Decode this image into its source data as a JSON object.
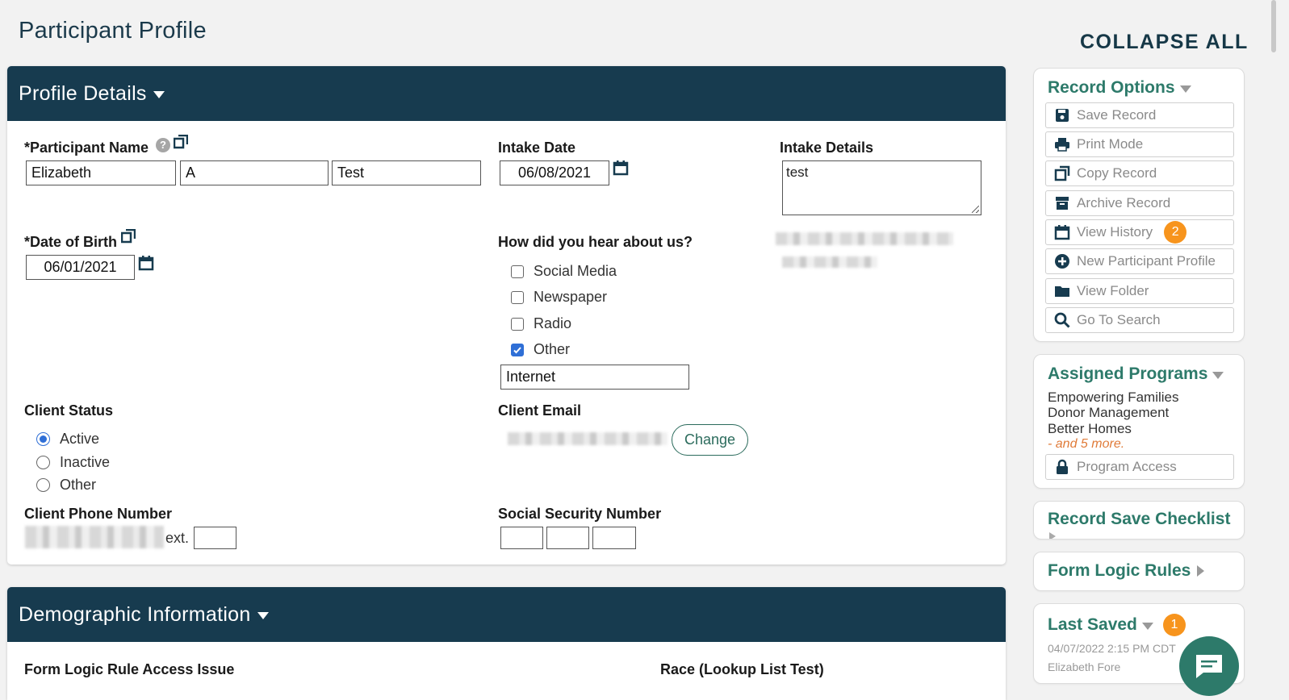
{
  "page": {
    "title": "Participant Profile",
    "collapse_all": "COLLAPSE ALL"
  },
  "profile_details": {
    "header": "Profile Details",
    "participant_name": {
      "label": "*Participant Name",
      "first": "Elizabeth",
      "middle": "A",
      "last": "Test"
    },
    "intake_date": {
      "label": "Intake Date",
      "value": "06/08/2021"
    },
    "intake_details": {
      "label": "Intake Details",
      "value": "test"
    },
    "date_of_birth": {
      "label": "*Date of Birth",
      "value": "06/01/2021"
    },
    "how_heard": {
      "label": "How did you hear about us?",
      "options": [
        {
          "label": "Social Media",
          "checked": false
        },
        {
          "label": "Newspaper",
          "checked": false
        },
        {
          "label": "Radio",
          "checked": false
        },
        {
          "label": "Other",
          "checked": true
        }
      ],
      "other_value": "Internet"
    },
    "client_status": {
      "label": "Client Status",
      "options": [
        "Active",
        "Inactive",
        "Other"
      ],
      "selected": "Active"
    },
    "client_email": {
      "label": "Client Email",
      "change_label": "Change"
    },
    "client_phone": {
      "label": "Client Phone Number",
      "ext_label": "ext."
    },
    "ssn": {
      "label": "Social Security Number"
    }
  },
  "demographic": {
    "header": "Demographic Information",
    "form_logic_issue_label": "Form Logic Rule Access Issue",
    "race_label": "Race (Lookup List Test)"
  },
  "sidebar": {
    "record_options": {
      "title": "Record Options",
      "buttons": [
        {
          "label": "Save Record",
          "icon": "save-icon"
        },
        {
          "label": "Print Mode",
          "icon": "print-icon"
        },
        {
          "label": "Copy Record",
          "icon": "copy-icon"
        },
        {
          "label": "Archive Record",
          "icon": "archive-icon"
        },
        {
          "label": "View History",
          "icon": "calendar-icon",
          "badge": "2"
        },
        {
          "label": "New Participant Profile",
          "icon": "plus-circle-icon"
        },
        {
          "label": "View Folder",
          "icon": "folder-icon"
        },
        {
          "label": "Go To Search",
          "icon": "search-icon"
        }
      ]
    },
    "assigned_programs": {
      "title": "Assigned Programs",
      "programs": [
        "Empowering Families",
        "Donor Management",
        "Better Homes"
      ],
      "more": "- and 5 more.",
      "access_button": "Program Access"
    },
    "save_checklist": {
      "title": "Record Save Checklist"
    },
    "form_logic": {
      "title": "Form Logic Rules"
    },
    "last_saved": {
      "title": "Last Saved",
      "badge": "1",
      "timestamp": "04/07/2022 2:15 PM CDT",
      "user": "Elizabeth Fore"
    }
  },
  "colors": {
    "header_bg": "#173b4f",
    "accent_green": "#2d7a6a",
    "badge_orange": "#f7941d",
    "checkbox_blue": "#2f6fd6"
  }
}
